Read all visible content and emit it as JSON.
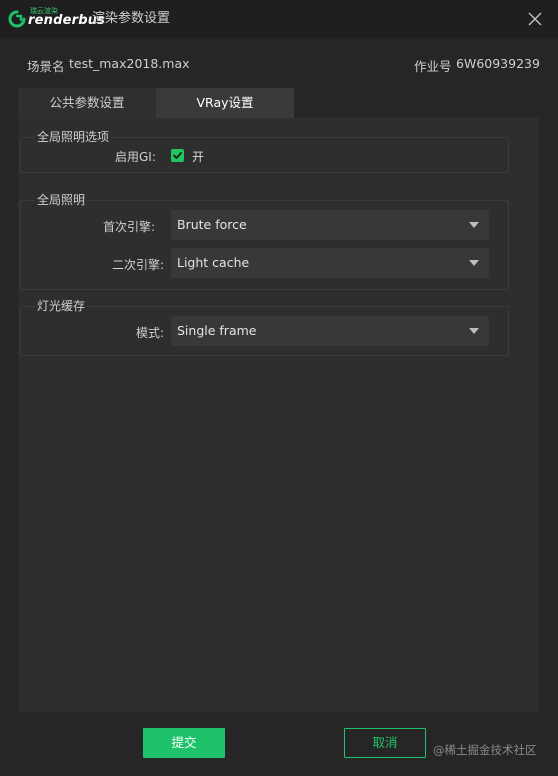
{
  "window": {
    "logo_sub": "瑞云渲染",
    "logo_main": "renderbus",
    "title": "渲染参数设置"
  },
  "info": {
    "scene_label": "场景名",
    "scene_value": "test_max2018.max",
    "job_label": "作业号",
    "job_value": "6W60939239"
  },
  "tabs": [
    {
      "label": "公共参数设置",
      "active": false
    },
    {
      "label": "VRay设置",
      "active": true
    }
  ],
  "groups": {
    "gi_options": {
      "title": "全局照明选项",
      "enable_label": "启用GI:",
      "enable_checked": true,
      "enable_text": "开"
    },
    "gi": {
      "title": "全局照明",
      "primary_label": "首次引擎:",
      "primary_value": "Brute force",
      "secondary_label": "二次引擎:",
      "secondary_value": "Light cache"
    },
    "light_cache": {
      "title": "灯光缓存",
      "mode_label": "模式:",
      "mode_value": "Single frame"
    }
  },
  "footer": {
    "submit_label": "提交",
    "cancel_label": "取消",
    "watermark": "@稀土掘金技术社区"
  },
  "colors": {
    "accent": "#1fc26a",
    "background": "#262626",
    "panel": "#2e2e2e",
    "select": "#383838"
  }
}
